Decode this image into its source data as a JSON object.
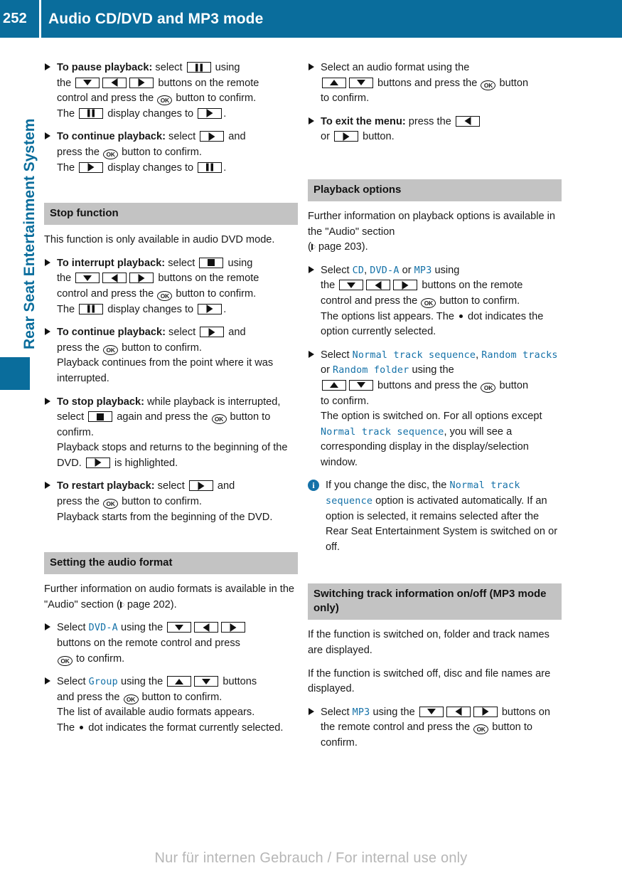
{
  "header": {
    "page_number": "252",
    "title": "Audio CD/DVD and MP3 mode",
    "bg_color": "#0a6d9c"
  },
  "rail": {
    "chapter_label": "Rear Seat Entertainment System",
    "color": "#0a6d9c"
  },
  "colors": {
    "accent_blue": "#0a6d9c",
    "term_blue": "#1471a8",
    "section_head_bg": "#c3c3c3",
    "watermark": "#b6b6b6"
  },
  "left_column": {
    "b1": {
      "lead": "To pause playback:",
      "t1": " select ",
      "t2": " using",
      "t3": "the ",
      "t4": " buttons on the remote",
      "t5": "control and press the ",
      "t6": " button to confirm.",
      "t7": "The ",
      "t8": " display changes to ",
      "t9": "."
    },
    "b2": {
      "lead": "To continue playback:",
      "t1": " select ",
      "t2": " and",
      "t3": "press the ",
      "t4": " button to confirm.",
      "t5": "The ",
      "t6": " display changes to ",
      "t7": "."
    },
    "stop_function": {
      "heading": "Stop function",
      "intro": "This function is only available in audio DVD mode.",
      "b1": {
        "lead": "To interrupt playback:",
        "t1": " select ",
        "t2": " using",
        "t3": "the ",
        "t4": " buttons on the remote",
        "t5": "control and press the ",
        "t6": " button to confirm.",
        "t7": "The ",
        "t8": " display changes to ",
        "t9": "."
      },
      "b2": {
        "lead": "To continue playback:",
        "t1": " select ",
        "t2": " and",
        "t3": "press the ",
        "t4": " button to confirm.",
        "t5": "Playback continues from the point where it was interrupted."
      },
      "b3": {
        "lead": "To stop playback:",
        "t1": " while playback is interrupted, select ",
        "t2": " again and press the ",
        "t3": " button to confirm.",
        "t4": "Playback stops and returns to the beginning of the DVD. ",
        "t5": " is highlighted."
      },
      "b4": {
        "lead": "To restart playback:",
        "t1": " select ",
        "t2": " and",
        "t3": "press the ",
        "t4": " button to confirm.",
        "t5": "Playback starts from the beginning of the DVD."
      }
    },
    "audio_format": {
      "heading": "Setting the audio format",
      "intro_a": "Further information on audio formats is available in the \"Audio\" section (",
      "intro_page": "page 202",
      "intro_b": ").",
      "b1": {
        "t1": "Select ",
        "term": "DVD-A",
        "t2": " using the ",
        "t3": "buttons on the remote control and press",
        "t4": " to confirm."
      },
      "b2": {
        "t1": "Select ",
        "term": "Group",
        "t2": " using the ",
        "t3": " buttons",
        "t4": "and press the ",
        "t5": " button to confirm.",
        "t6": "The list of available audio formats appears.",
        "t7": "The ",
        "t8": " dot indicates the format currently selected."
      }
    }
  },
  "right_column": {
    "b1": {
      "t1": "Select an audio format using the",
      "t2": " buttons and press the ",
      "t3": " button",
      "t4": "to confirm."
    },
    "b2": {
      "lead": "To exit the menu:",
      "t1": " press the ",
      "t2": "or ",
      "t3": " button."
    },
    "playback_options": {
      "heading": "Playback options",
      "intro_a": "Further information on playback options is available in the \"Audio\" section",
      "intro_open": "(",
      "intro_page": "page 203",
      "intro_b": ").",
      "b1": {
        "t1": "Select ",
        "term1": "CD",
        "t2": ", ",
        "term2": "DVD-A",
        "t3": " or ",
        "term3": "MP3",
        "t4": " using",
        "t5": "the ",
        "t6": " buttons on the remote",
        "t7": "control and press the ",
        "t8": " button to confirm.",
        "t9": "The options list appears. The ",
        "t10": " dot indicates the option currently selected."
      },
      "b2": {
        "t1": "Select ",
        "term1": "Normal track sequence",
        "t2": ", ",
        "term2": "Random tracks",
        "t3": " or ",
        "term3": "Random folder",
        "t4": " using the",
        "t5": " buttons and press the ",
        "t6": " button",
        "t7": "to confirm.",
        "t8": "The option is switched on. For all options except ",
        "term4": "Normal track sequence",
        "t9": ", you will see a corresponding display in the display/selection window."
      },
      "note": {
        "t1": "If you change the disc, the ",
        "term": "Normal track sequence",
        "t2": " option is activated automatically. If an option is selected, it remains selected after the Rear Seat Entertainment System is switched on or off."
      }
    },
    "track_info": {
      "heading": "Switching track information on/off (MP3 mode only)",
      "p1": "If the function is switched on, folder and track names are displayed.",
      "p2": "If the function is switched off, disc and file names are displayed.",
      "b1": {
        "t1": "Select ",
        "term": "MP3",
        "t2": " using the ",
        "t3": " buttons on the remote control and press the ",
        "t4": " button to confirm."
      }
    }
  },
  "footer": {
    "watermark": "Nur für internen Gebrauch / For internal use only"
  },
  "icons": {
    "pause": "pause-icon",
    "play": "play-icon",
    "stop": "stop-icon",
    "up": "arrow-up-icon",
    "down": "arrow-down-icon",
    "left": "arrow-left-icon",
    "right": "arrow-right-icon",
    "ok": "ok-button-icon",
    "info": "info-icon",
    "page_ref": "page-reference-arrow-icon",
    "bullet": "bullet-triangle-icon",
    "selection_dot": "selection-dot-icon"
  },
  "ok_label": "OK",
  "info_label": "i"
}
